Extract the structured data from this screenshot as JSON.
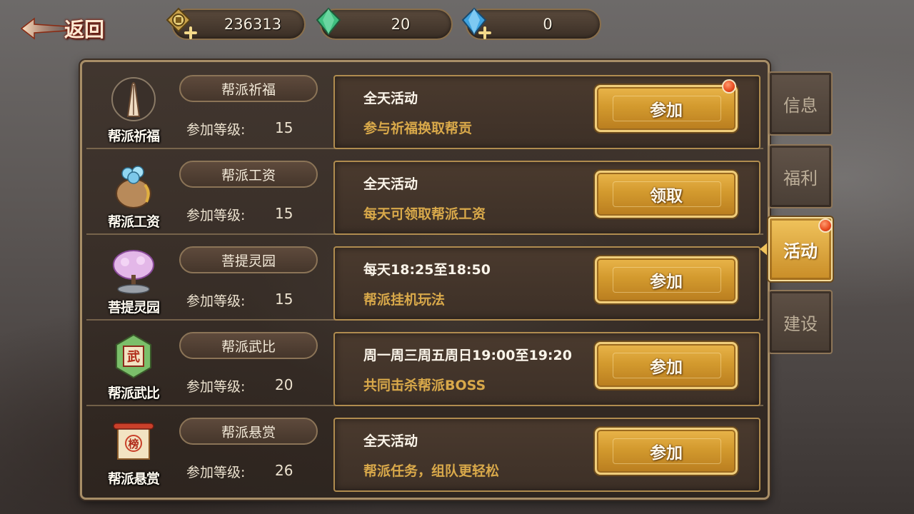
{
  "top_bar": {
    "back_label": "返回",
    "currencies": [
      {
        "name": "coin",
        "value": "236313",
        "icon": "coin-icon"
      },
      {
        "name": "green-jade",
        "value": "20",
        "icon": "green-gem-icon"
      },
      {
        "name": "blue-diamond",
        "value": "0",
        "icon": "blue-gem-icon"
      }
    ]
  },
  "level_label": "参加等级:",
  "activities": [
    {
      "icon": "praying-hands-icon",
      "icon_caption": "帮派祈福",
      "name": "帮派祈福",
      "level": "15",
      "time": "全天活动",
      "desc": "参与祈福换取帮贡",
      "button": "参加",
      "notify": true
    },
    {
      "icon": "money-bag-icon",
      "icon_caption": "帮派工资",
      "name": "帮派工资",
      "level": "15",
      "time": "全天活动",
      "desc": "每天可领取帮派工资",
      "button": "领取",
      "notify": false
    },
    {
      "icon": "bodhi-tree-icon",
      "icon_caption": "菩提灵园",
      "name": "菩提灵园",
      "level": "15",
      "time": "每天18:25至18:50",
      "desc": "帮派挂机玩法",
      "button": "参加",
      "notify": false
    },
    {
      "icon": "martial-scroll-icon",
      "icon_caption": "帮派武比",
      "name": "帮派武比",
      "level": "20",
      "time": "周一周三周五周日19:00至19:20",
      "desc": "共同击杀帮派BOSS",
      "button": "参加",
      "notify": false
    },
    {
      "icon": "bounty-scroll-icon",
      "icon_caption": "帮派悬赏",
      "name": "帮派悬赏",
      "level": "26",
      "time": "全天活动",
      "desc": "帮派任务，组队更轻松",
      "button": "参加",
      "notify": false
    }
  ],
  "tabs": [
    {
      "label": "信息",
      "active": false,
      "notify": false
    },
    {
      "label": "福利",
      "active": false,
      "notify": false
    },
    {
      "label": "活动",
      "active": true,
      "notify": true
    },
    {
      "label": "建设",
      "active": false,
      "notify": false
    }
  ],
  "colors": {
    "accent_gold": "#d39a2e",
    "desc_text": "#d9a94a",
    "panel_border": "#a88e67",
    "notify_red": "#e84a1f"
  }
}
